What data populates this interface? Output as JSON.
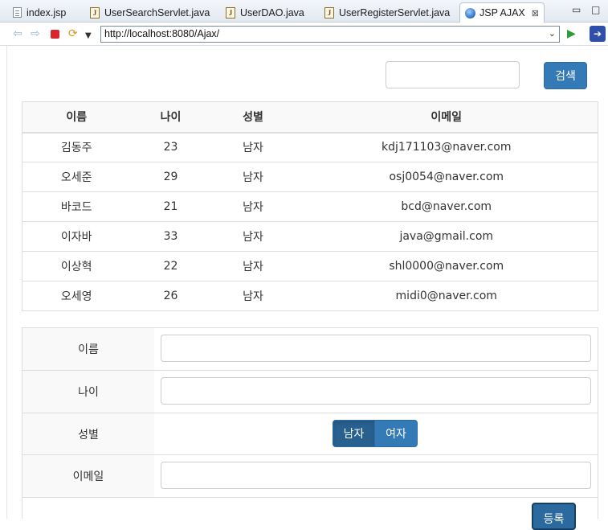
{
  "tabs": [
    {
      "label": "index.jsp",
      "icon": "file-icon"
    },
    {
      "label": "UserSearchServlet.java",
      "icon": "java-file-icon"
    },
    {
      "label": "UserDAO.java",
      "icon": "java-file-icon"
    },
    {
      "label": "UserRegisterServlet.java",
      "icon": "java-file-icon"
    },
    {
      "label": "JSP AJAX",
      "icon": "globe-icon",
      "active": true
    }
  ],
  "browser": {
    "url": "http://localhost:8080/Ajax/"
  },
  "search": {
    "value": "",
    "button_label": "검색"
  },
  "table": {
    "headers": [
      "이름",
      "나이",
      "성별",
      "이메일"
    ],
    "rows": [
      [
        "김동주",
        "23",
        "남자",
        "kdj171103@naver.com"
      ],
      [
        "오세준",
        "29",
        "남자",
        "osj0054@naver.com"
      ],
      [
        "바코드",
        "21",
        "남자",
        "bcd@naver.com"
      ],
      [
        "이자바",
        "33",
        "남자",
        "java@gmail.com"
      ],
      [
        "이상혁",
        "22",
        "남자",
        "shl0000@naver.com"
      ],
      [
        "오세영",
        "26",
        "남자",
        "midi0@naver.com"
      ]
    ]
  },
  "form": {
    "name_label": "이름",
    "age_label": "나이",
    "gender_label": "성별",
    "email_label": "이메일",
    "gender_options": [
      "남자",
      "여자"
    ],
    "gender_selected": "남자",
    "register_label": "등록"
  },
  "colors": {
    "primary": "#337ab7",
    "primary_active": "#286090",
    "header_bg": "#f9f9f9"
  }
}
